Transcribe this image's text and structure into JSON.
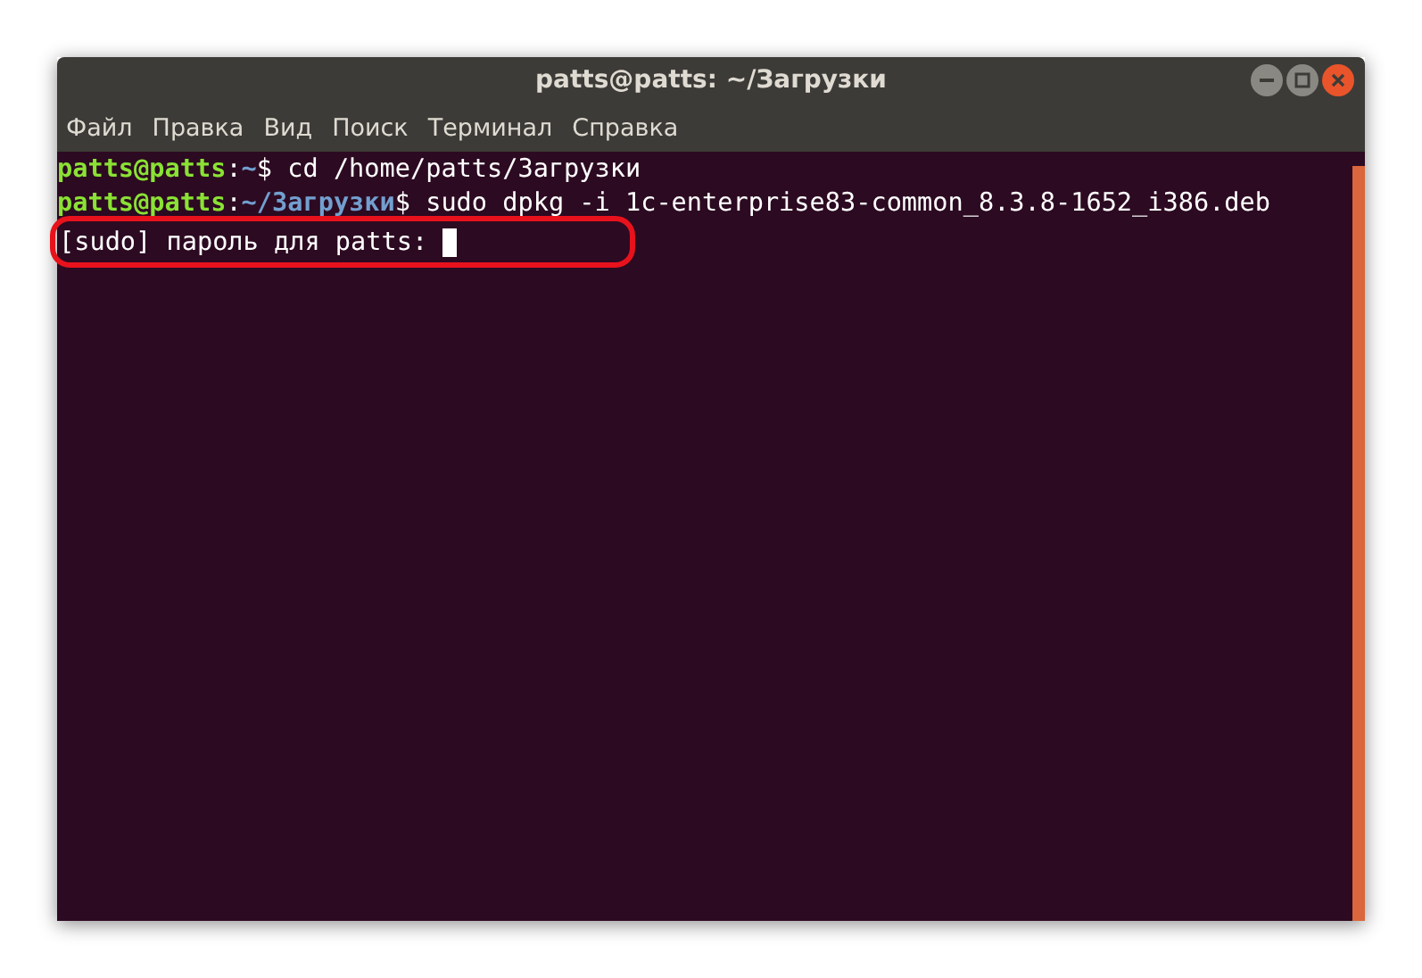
{
  "window": {
    "title": "patts@patts: ~/Загрузки"
  },
  "menu": [
    "Файл",
    "Правка",
    "Вид",
    "Поиск",
    "Терминал",
    "Справка"
  ],
  "lines": [
    {
      "segments": [
        {
          "kind": "user",
          "text": "patts@patts"
        },
        {
          "kind": "plain",
          "text": ":"
        },
        {
          "kind": "path",
          "text": "~"
        },
        {
          "kind": "plain",
          "text": "$ cd /home/patts/Загрузки"
        }
      ]
    },
    {
      "segments": [
        {
          "kind": "user",
          "text": "patts@patts"
        },
        {
          "kind": "plain",
          "text": ":"
        },
        {
          "kind": "path",
          "text": "~/Загрузки"
        },
        {
          "kind": "plain",
          "text": "$ sudo dpkg -i 1c-enterprise83-common_8.3.8-1652_i386.deb"
        }
      ]
    }
  ],
  "prompt": {
    "text": "[sudo] пароль для patts: ",
    "highlighted": true,
    "cursor": true
  }
}
